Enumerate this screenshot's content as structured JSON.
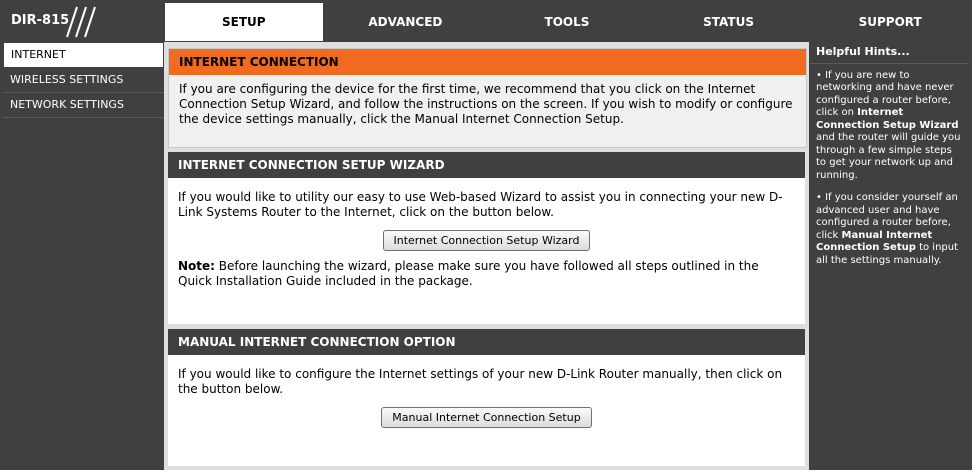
{
  "header": {
    "model": "DIR-815",
    "tabs": [
      "SETUP",
      "ADVANCED",
      "TOOLS",
      "STATUS",
      "SUPPORT"
    ],
    "active_tab": "SETUP"
  },
  "sidebar": {
    "items": [
      "INTERNET",
      "WIRELESS SETTINGS",
      "NETWORK SETTINGS"
    ],
    "active": "INTERNET"
  },
  "intro": {
    "title": "INTERNET CONNECTION",
    "text": "If you are configuring the device for the first time, we recommend that you click on the Internet Connection Setup Wizard, and follow the instructions on the screen. If you wish to modify or configure the device settings manually, click the Manual Internet Connection Setup."
  },
  "wizard": {
    "title": "INTERNET CONNECTION SETUP WIZARD",
    "text": "If you would like to utility our easy to use Web-based Wizard to assist you in connecting your new D-Link Systems Router to the Internet, click on the button below.",
    "button": "Internet Connection Setup Wizard",
    "note_label": "Note:",
    "note_text": " Before launching the wizard, please make sure you have followed all steps outlined in the Quick Installation Guide included in the package."
  },
  "manual": {
    "title": "MANUAL INTERNET CONNECTION OPTION",
    "text": "If you would like to configure the Internet settings of your new D-Link Router manually, then click on the button below.",
    "button": "Manual Internet Connection Setup"
  },
  "hints": {
    "title": "Helpful Hints...",
    "hint1_a": "• If you are new to networking and have never configured a router before, click on ",
    "hint1_b": "Internet Connection Setup Wizard",
    "hint1_c": " and the router will guide you through a few simple steps to get your network up and running.",
    "hint2_a": "• If you consider yourself an advanced user and have configured a router before, click ",
    "hint2_b": "Manual Internet Connection Setup",
    "hint2_c": " to input all the settings manually."
  },
  "colors": {
    "dark": "#404040",
    "accent": "#f06b1f"
  }
}
